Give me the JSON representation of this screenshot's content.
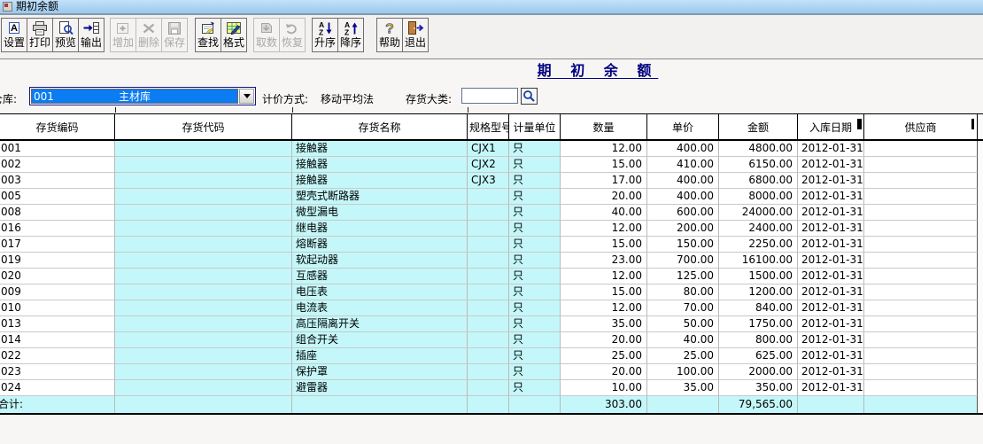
{
  "window": {
    "title": "期初余额"
  },
  "colors": {
    "row_highlight": "#c4f7f9",
    "selection_blue": "#0b7cf2",
    "report_title_navy": "#00007e",
    "titlebar_blue": "#a9d2f3"
  },
  "toolbar": {
    "buttons": [
      {
        "label": "设置",
        "enabled": true
      },
      {
        "label": "打印",
        "enabled": true
      },
      {
        "label": "预览",
        "enabled": true
      },
      {
        "label": "输出",
        "enabled": true
      },
      {
        "label": "增加",
        "enabled": false
      },
      {
        "label": "删除",
        "enabled": false
      },
      {
        "label": "保存",
        "enabled": false
      },
      {
        "label": "查找",
        "enabled": true
      },
      {
        "label": "格式",
        "enabled": true
      },
      {
        "label": "取数",
        "enabled": false
      },
      {
        "label": "恢复",
        "enabled": false
      },
      {
        "label": "升序",
        "enabled": true
      },
      {
        "label": "降序",
        "enabled": true
      },
      {
        "label": "帮助",
        "enabled": true
      },
      {
        "label": "退出",
        "enabled": true
      }
    ]
  },
  "report": {
    "title": "期 初 余 额"
  },
  "filters": {
    "warehouse_label": "仓库:",
    "warehouse_code": "001",
    "warehouse_name": "主材库",
    "pricing_label": "计价方式:",
    "pricing_value": "移动平均法",
    "category_label": "存货大类:",
    "category_value": ""
  },
  "table": {
    "headers": [
      "存货编码",
      "存货代码",
      "存货名称",
      "规格型号",
      "计量单位",
      "数量",
      "单价",
      "金额",
      "入库日期",
      "供应商"
    ],
    "rows": [
      [
        "001",
        "",
        "接触器",
        "CJX1",
        "只",
        "12.00",
        "400.00",
        "4800.00",
        "2012-01-31",
        ""
      ],
      [
        "002",
        "",
        "接触器",
        "CJX2",
        "只",
        "15.00",
        "410.00",
        "6150.00",
        "2012-01-31",
        ""
      ],
      [
        "003",
        "",
        "接触器",
        "CJX3",
        "只",
        "17.00",
        "400.00",
        "6800.00",
        "2012-01-31",
        ""
      ],
      [
        "005",
        "",
        "塑壳式断路器",
        "",
        "只",
        "20.00",
        "400.00",
        "8000.00",
        "2012-01-31",
        ""
      ],
      [
        "008",
        "",
        "微型漏电",
        "",
        "只",
        "40.00",
        "600.00",
        "24000.00",
        "2012-01-31",
        ""
      ],
      [
        "016",
        "",
        "继电器",
        "",
        "只",
        "12.00",
        "200.00",
        "2400.00",
        "2012-01-31",
        ""
      ],
      [
        "017",
        "",
        "熔断器",
        "",
        "只",
        "15.00",
        "150.00",
        "2250.00",
        "2012-01-31",
        ""
      ],
      [
        "019",
        "",
        "软起动器",
        "",
        "只",
        "23.00",
        "700.00",
        "16100.00",
        "2012-01-31",
        ""
      ],
      [
        "020",
        "",
        "互感器",
        "",
        "只",
        "12.00",
        "125.00",
        "1500.00",
        "2012-01-31",
        ""
      ],
      [
        "009",
        "",
        "电压表",
        "",
        "只",
        "15.00",
        "80.00",
        "1200.00",
        "2012-01-31",
        ""
      ],
      [
        "010",
        "",
        "电流表",
        "",
        "只",
        "12.00",
        "70.00",
        "840.00",
        "2012-01-31",
        ""
      ],
      [
        "013",
        "",
        "高压隔离开关",
        "",
        "只",
        "35.00",
        "50.00",
        "1750.00",
        "2012-01-31",
        ""
      ],
      [
        "014",
        "",
        "组合开关",
        "",
        "只",
        "20.00",
        "40.00",
        "800.00",
        "2012-01-31",
        ""
      ],
      [
        "022",
        "",
        "插座",
        "",
        "只",
        "25.00",
        "25.00",
        "625.00",
        "2012-01-31",
        ""
      ],
      [
        "023",
        "",
        "保护罩",
        "",
        "只",
        "20.00",
        "100.00",
        "2000.00",
        "2012-01-31",
        ""
      ],
      [
        "024",
        "",
        "避雷器",
        "",
        "只",
        "10.00",
        "35.00",
        "350.00",
        "2012-01-31",
        ""
      ]
    ],
    "totals": [
      "合计:",
      "",
      "",
      "",
      "",
      "303.00",
      "",
      "79,565.00",
      "",
      ""
    ]
  }
}
